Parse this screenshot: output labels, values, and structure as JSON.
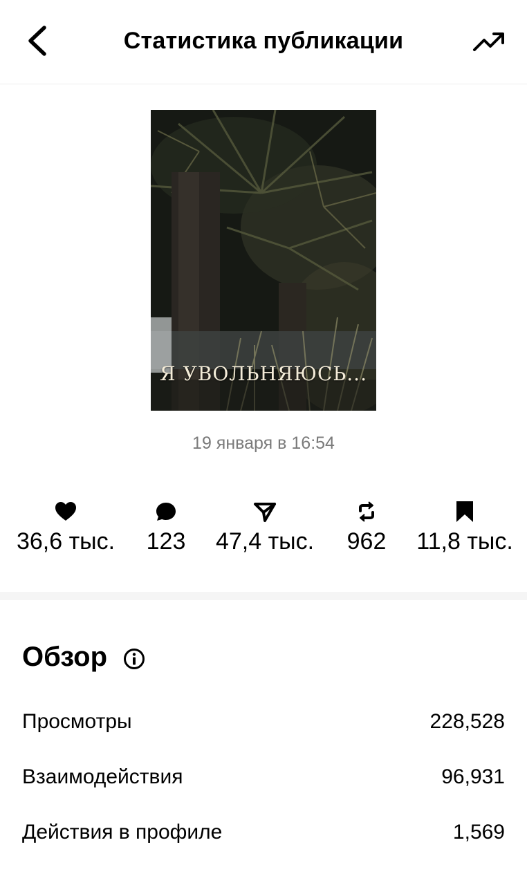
{
  "header": {
    "title": "Статистика публикации"
  },
  "post": {
    "image_text": "Я УВОЛЬНЯЮСЬ...",
    "date": "19 января в 16:54"
  },
  "stats": {
    "likes": "36,6 тыс.",
    "comments": "123",
    "shares": "47,4 тыс.",
    "reposts": "962",
    "saves": "11,8 тыс."
  },
  "overview": {
    "title": "Обзор",
    "rows": [
      {
        "label": "Просмотры",
        "value": "228,528"
      },
      {
        "label": "Взаимодействия",
        "value": "96,931"
      },
      {
        "label": "Действия в профиле",
        "value": "1,569"
      }
    ]
  },
  "icons": {
    "back": "chevron-left-icon",
    "trend": "trending-up-icon",
    "like": "heart-icon",
    "comment": "comment-bubble-icon",
    "share": "paper-plane-icon",
    "repost": "repost-icon",
    "save": "bookmark-icon",
    "info": "info-icon"
  }
}
